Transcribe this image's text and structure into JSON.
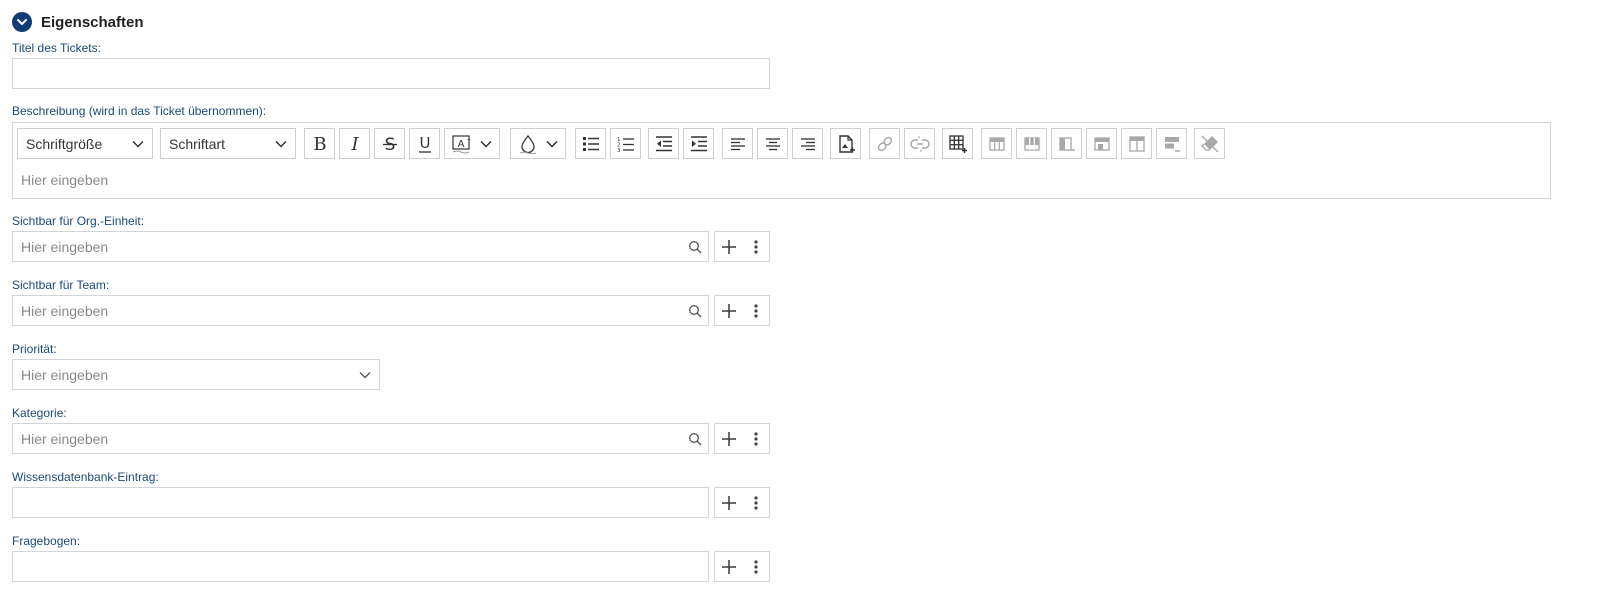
{
  "section": {
    "title": "Eigenschaften",
    "icon": "chevron-down-icon"
  },
  "fields": {
    "title": {
      "label": "Titel des Tickets:",
      "value": ""
    },
    "description": {
      "label": "Beschreibung (wird in das Ticket übernommen):",
      "font_size_label": "Schriftgröße",
      "font_family_label": "Schriftart",
      "placeholder": "Hier eingeben"
    },
    "org_unit": {
      "label": "Sichtbar für Org.-Einheit:",
      "placeholder": "Hier eingeben"
    },
    "team": {
      "label": "Sichtbar für Team:",
      "placeholder": "Hier eingeben"
    },
    "priority": {
      "label": "Priorität:",
      "placeholder": "Hier eingeben"
    },
    "category": {
      "label": "Kategorie:",
      "placeholder": "Hier eingeben"
    },
    "knowledge_base": {
      "label": "Wissensdatenbank-Eintrag:",
      "value": ""
    },
    "questionnaire": {
      "label": "Fragebogen:",
      "value": ""
    }
  },
  "colors": {
    "accent": "#0e3c74",
    "label": "#1b4a7a",
    "border": "#d4d4d4",
    "placeholder": "#8a8a8a",
    "disabled_icon": "#a8a8a8"
  }
}
